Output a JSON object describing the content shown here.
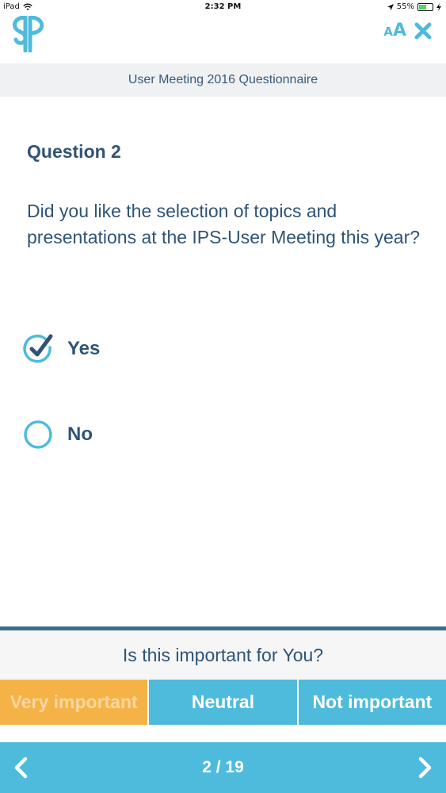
{
  "status_bar": {
    "carrier": "iPad",
    "time": "2:32 PM",
    "battery_percent": "55%",
    "battery_level": 0.55
  },
  "header": {
    "logo_icon": "ips-logo-icon",
    "font_size_label_small": "A",
    "font_size_label_big": "A",
    "close_icon": "close-icon"
  },
  "title_bar": {
    "title": "User Meeting 2016 Questionnaire"
  },
  "question": {
    "label": "Question 2",
    "text": "Did you like the selection of topics and presentations at the IPS-User Meeting this year?",
    "options": [
      {
        "label": "Yes",
        "selected": true
      },
      {
        "label": "No",
        "selected": false
      }
    ]
  },
  "importance": {
    "prompt": "Is this important for You?",
    "buttons": [
      {
        "label": "Very important",
        "selected": true
      },
      {
        "label": "Neutral",
        "selected": false
      },
      {
        "label": "Not important",
        "selected": false
      }
    ]
  },
  "navigation": {
    "page_indicator": "2 / 19",
    "prev_icon": "chevron-left-icon",
    "next_icon": "chevron-right-icon"
  },
  "colors": {
    "accent": "#4fbbdc",
    "selected_orange": "#f5b347",
    "text_dark_blue": "#2f5476",
    "divider": "#3b6f8c"
  }
}
